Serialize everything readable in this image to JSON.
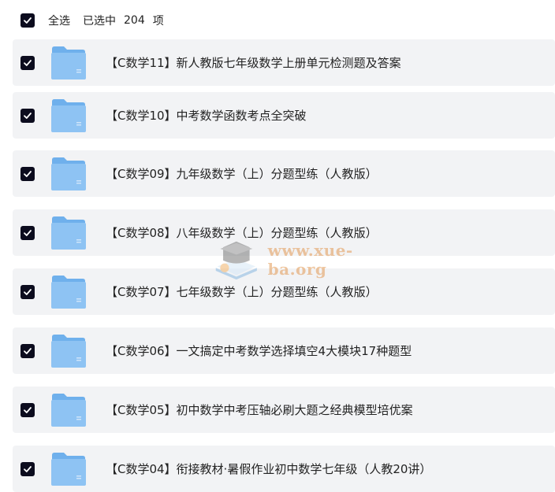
{
  "toolbar": {
    "select_all_label": "全选",
    "selected_prefix": "已选中",
    "selected_count": "204",
    "selected_unit": "项"
  },
  "files": [
    {
      "name": "【C数学11】新人教版七年级数学上册单元检测题及答案",
      "checked": true
    },
    {
      "name": "【C数学10】中考数学函数考点全突破",
      "checked": true
    },
    {
      "name": "【C数学09】九年级数学（上）分题型练（人教版）",
      "checked": true
    },
    {
      "name": "【C数学08】八年级数学（上）分题型练（人教版）",
      "checked": true
    },
    {
      "name": "【C数学07】七年级数学（上）分题型练（人教版）",
      "checked": true
    },
    {
      "name": "【C数学06】一文搞定中考数学选择填空4大模块17种题型",
      "checked": true
    },
    {
      "name": "【C数学05】初中数学中考压轴必刷大题之经典模型培优案",
      "checked": true
    },
    {
      "name": "【C数学04】衔接教材·暑假作业初中数学七年级（人教20讲）",
      "checked": true
    }
  ],
  "watermark": {
    "text": "www.xue-ba.org"
  },
  "icons": {
    "checkbox": "checkmark-icon",
    "folder": "folder-icon"
  },
  "colors": {
    "checkbox_bg": "#0c0c1e",
    "row_bg": "#f2f3f5",
    "folder": "#8ec3f3"
  }
}
